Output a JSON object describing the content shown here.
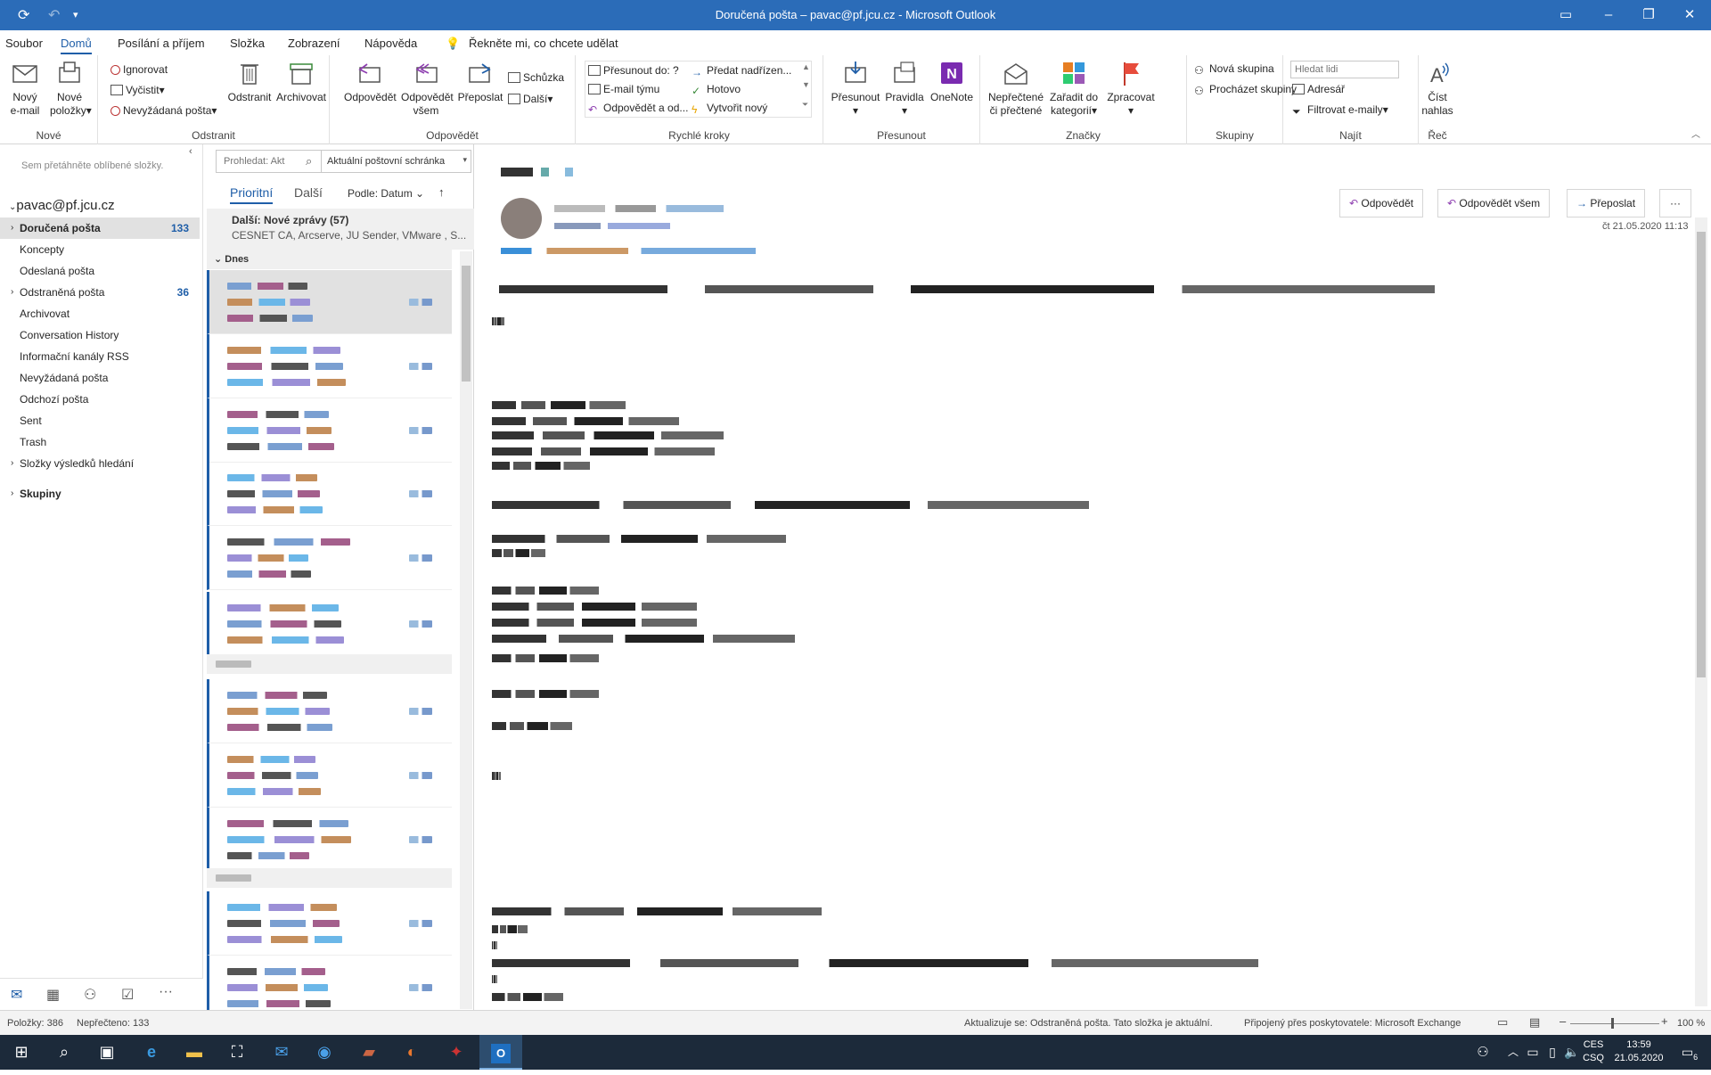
{
  "window": {
    "title": "Doručená pošta – pavac@pf.jcu.cz  -  Microsoft Outlook"
  },
  "menu": [
    "Soubor",
    "Domů",
    "Posílání a příjem",
    "Složka",
    "Zobrazení",
    "Nápověda"
  ],
  "menu_active": "Domů",
  "tellme": "Řekněte mi, co chcete udělat",
  "ribbon": {
    "new_group": "Nové",
    "new_email": [
      "Nový",
      "e-mail"
    ],
    "new_items": [
      "Nové",
      "položky"
    ],
    "delete_group": "Odstranit",
    "ignore": "Ignorovat",
    "cleanup": "Vyčistit",
    "junk": "Nevyžádaná pošta",
    "delete": "Odstranit",
    "archive": "Archivovat",
    "respond_group": "Odpovědět",
    "reply": "Odpovědět",
    "reply_all": [
      "Odpovědět",
      "všem"
    ],
    "forward": "Přeposlat",
    "meeting": "Schůzka",
    "more": "Další",
    "quicksteps_group": "Rychlé kroky",
    "qs": [
      "Přesunout do: ?",
      "E-mail týmu",
      "Odpovědět a od...",
      "Předat nadřízen...",
      "Hotovo",
      "Vytvořit nový"
    ],
    "move_group": "Přesunout",
    "move": "Přesunout",
    "rules": "Pravidla",
    "onenote": "OneNote",
    "tags_group": "Značky",
    "unread": [
      "Nepřečtené",
      "či přečtené"
    ],
    "categorize": [
      "Zařadit do",
      "kategorií"
    ],
    "followup": "Zpracovat",
    "groups_group": "Skupiny",
    "new_group_btn": "Nová skupina",
    "browse_groups": "Procházet skupiny",
    "find_group": "Najít",
    "search_people": "Hledat lidi",
    "address_book": "Adresář",
    "filter_email": "Filtrovat e-maily",
    "speech_group": "Řeč",
    "read_aloud": [
      "Číst",
      "nahlas"
    ]
  },
  "folders": {
    "favorites_hint": "Sem přetáhněte oblíbené složky.",
    "account": "pavac@pf.jcu.cz",
    "items": [
      {
        "name": "Doručená pošta",
        "count": "133",
        "selected": true,
        "expand": true
      },
      {
        "name": "Koncepty",
        "count": ""
      },
      {
        "name": "Odeslaná pošta",
        "count": ""
      },
      {
        "name": "Odstraněná pošta",
        "count": "36",
        "expand": true
      },
      {
        "name": "Archivovat",
        "count": ""
      },
      {
        "name": "Conversation History",
        "count": ""
      },
      {
        "name": "Informační kanály RSS",
        "count": ""
      },
      {
        "name": "Nevyžádaná pošta",
        "count": ""
      },
      {
        "name": "Odchozí pošta",
        "count": ""
      },
      {
        "name": "Sent",
        "count": ""
      },
      {
        "name": "Trash",
        "count": ""
      },
      {
        "name": "Složky výsledků hledání",
        "count": "",
        "expand": true
      }
    ],
    "groups": "Skupiny"
  },
  "list": {
    "search_placeholder": "Prohledat: Akt",
    "scope": "Aktuální poštovní schránka",
    "tab_focused": "Prioritní",
    "tab_other": "Další",
    "sort": "Podle: Datum",
    "other_title": "Další: Nové zprávy (57)",
    "other_senders": "CESNET CA, Arcserve, JU Sender, VMware , S...",
    "group_today": "Dnes"
  },
  "reading": {
    "reply": "Odpovědět",
    "reply_all": "Odpovědět všem",
    "forward": "Přeposlat",
    "date": "čt 21.05.2020 11:13"
  },
  "status": {
    "items": "Položky: 386",
    "unread": "Nepřečteno: 133",
    "update": "Aktualizuje se: Odstraněná pošta.  Tato složka je aktuální.",
    "connected": "Připojený přes poskytovatele: Microsoft Exchange",
    "zoom": "100 %"
  },
  "taskbar": {
    "lang1": "CES",
    "lang2": "CSQ",
    "time": "13:59",
    "date": "21.05.2020",
    "notif": "6"
  },
  "colors": {
    "accent": "#2b6cb8",
    "taskbar": "#1c2a3a"
  }
}
